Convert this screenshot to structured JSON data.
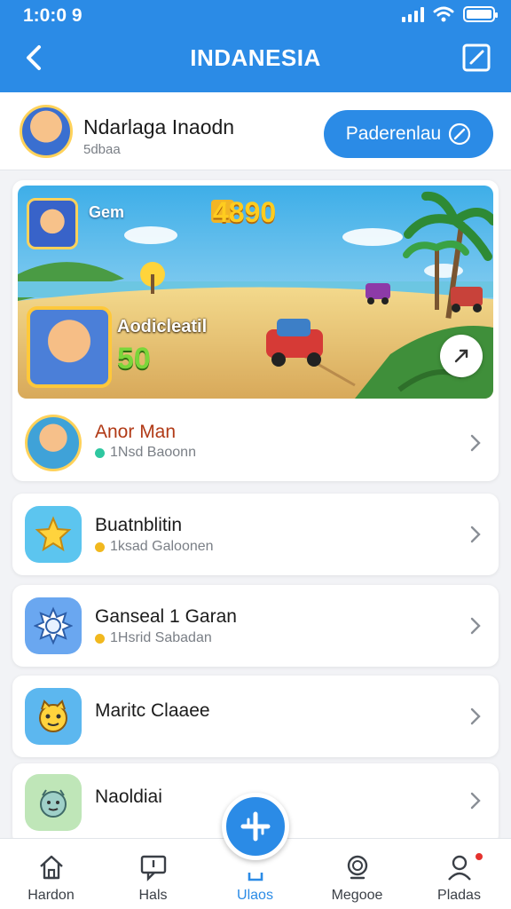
{
  "status": {
    "time": "1:0:0 9"
  },
  "header": {
    "title": "INDANESIA",
    "back_icon": "chevron-left-icon",
    "edit_icon": "edit-square-icon"
  },
  "profile": {
    "name": "Ndarlaga Inaodn",
    "subtitle": "5dbaa",
    "button_label": "Paderenlau"
  },
  "banner": {
    "gem_label": "Gem",
    "score": "4890",
    "player_name": "Aodicleatil",
    "level": "50"
  },
  "rows": [
    {
      "title": "Anor Man",
      "subtitle": "1Nsd Baoonn",
      "dot_color": "#2fc7a0"
    },
    {
      "title": "Buatnblitin",
      "subtitle": "1ksad Galoonen",
      "dot_color": "#f1b81e"
    },
    {
      "title": "Ganseal 1 Garan",
      "subtitle": "1Hsrid Sabadan",
      "dot_color": "#f1b81e"
    },
    {
      "title": "Maritc Claaee",
      "subtitle": ""
    },
    {
      "title": "Naoldiai",
      "subtitle": ""
    }
  ],
  "nav": [
    {
      "label": "Hardon",
      "icon": "home-icon"
    },
    {
      "label": "Hals",
      "icon": "chat-icon"
    },
    {
      "label": "Ulaos",
      "icon": "bookmark-icon"
    },
    {
      "label": "Megooe",
      "icon": "search-icon"
    },
    {
      "label": "Pladas",
      "icon": "profile-icon"
    }
  ],
  "colors": {
    "accent": "#2b8be6",
    "background": "#f2f3f6"
  }
}
